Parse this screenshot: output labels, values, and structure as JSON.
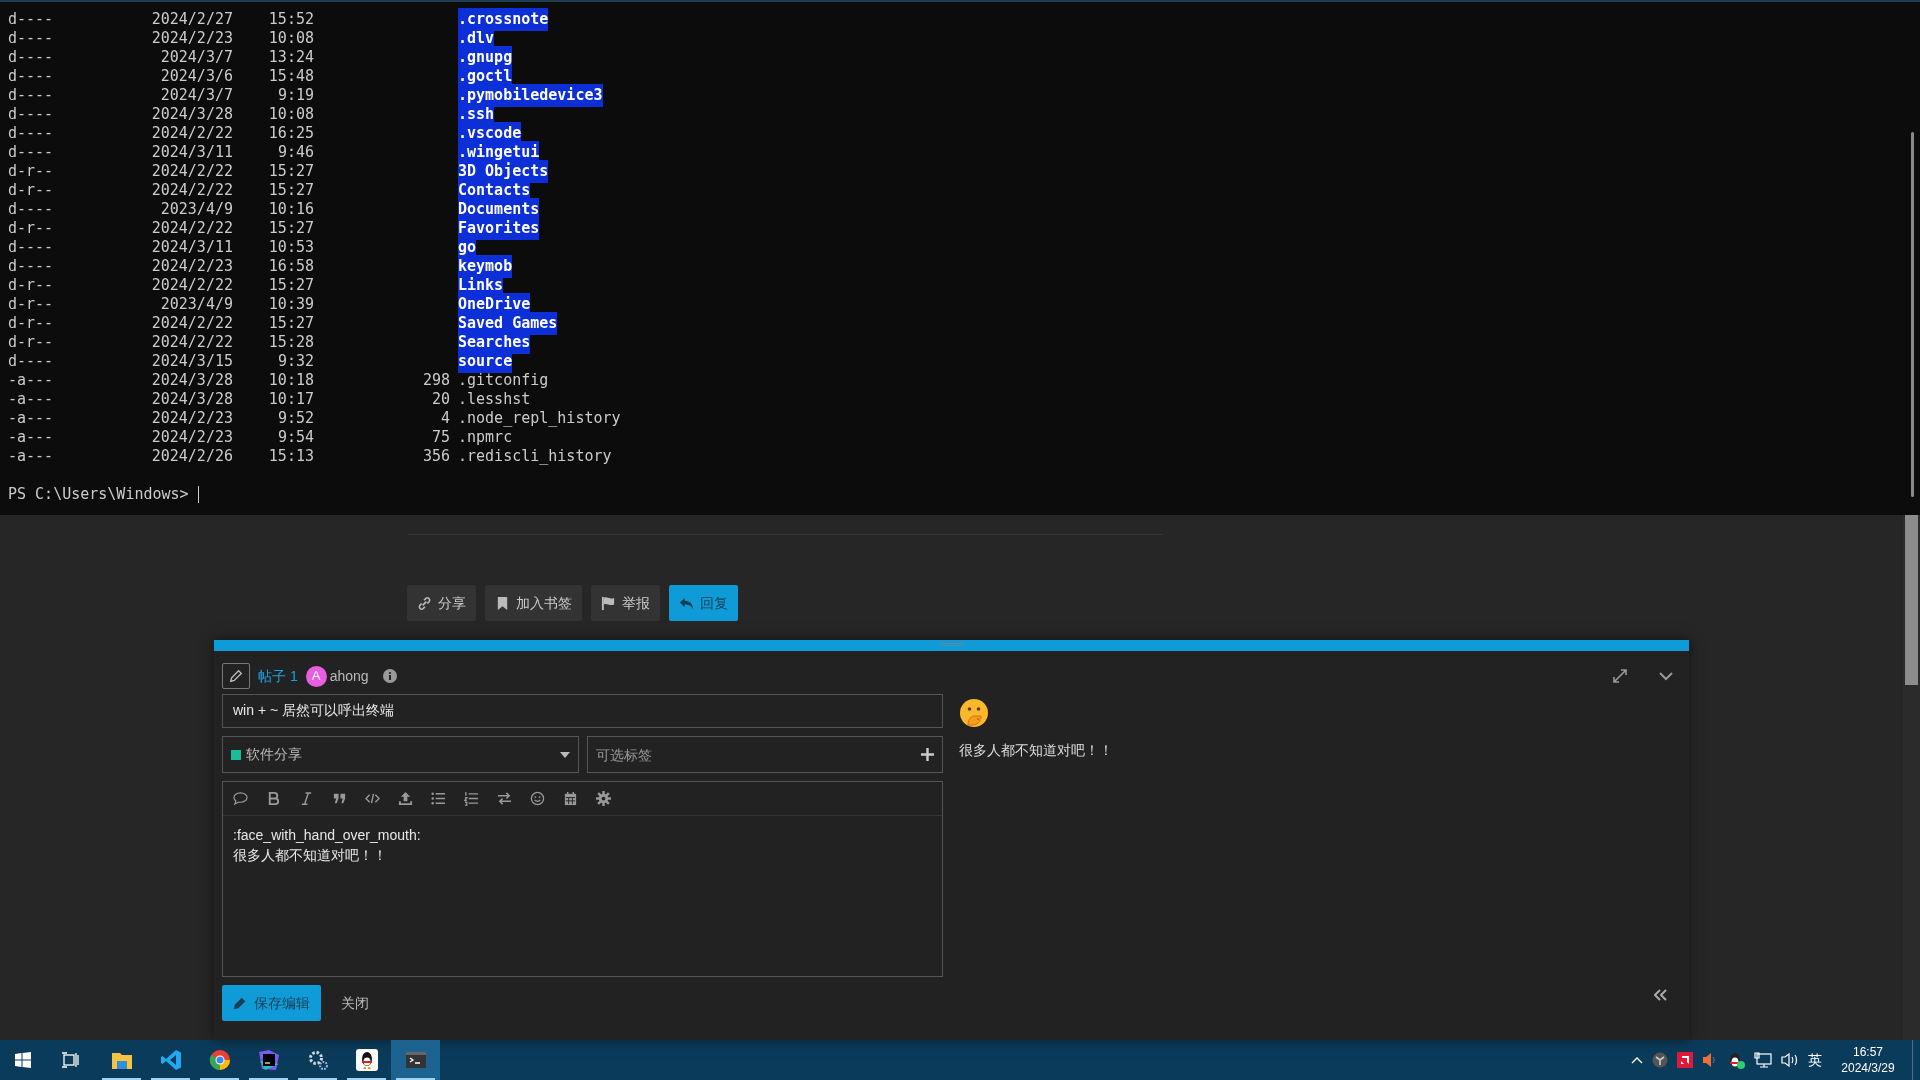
{
  "terminal": {
    "rows": [
      {
        "kind": "directory",
        "mode": "d----",
        "date": "2024/2/27",
        "time": "15:52",
        "name": ".crossnote"
      },
      {
        "kind": "directory",
        "mode": "d----",
        "date": "2024/2/23",
        "time": "10:08",
        "name": ".dlv"
      },
      {
        "kind": "directory",
        "mode": "d----",
        "date": "2024/3/7",
        "time": "13:24",
        "name": ".gnupg"
      },
      {
        "kind": "directory",
        "mode": "d----",
        "date": "2024/3/6",
        "time": "15:48",
        "name": ".goctl"
      },
      {
        "kind": "directory",
        "mode": "d----",
        "date": "2024/3/7",
        "time": "9:19",
        "name": ".pymobiledevice3"
      },
      {
        "kind": "directory",
        "mode": "d----",
        "date": "2024/3/28",
        "time": "10:08",
        "name": ".ssh"
      },
      {
        "kind": "directory",
        "mode": "d----",
        "date": "2024/2/22",
        "time": "16:25",
        "name": ".vscode"
      },
      {
        "kind": "directory",
        "mode": "d----",
        "date": "2024/3/11",
        "time": "9:46",
        "name": ".wingetui"
      },
      {
        "kind": "directory",
        "mode": "d-r--",
        "date": "2024/2/22",
        "time": "15:27",
        "name": "3D Objects"
      },
      {
        "kind": "directory",
        "mode": "d-r--",
        "date": "2024/2/22",
        "time": "15:27",
        "name": "Contacts"
      },
      {
        "kind": "directory",
        "mode": "d----",
        "date": "2023/4/9",
        "time": "10:16",
        "name": "Documents"
      },
      {
        "kind": "directory",
        "mode": "d-r--",
        "date": "2024/2/22",
        "time": "15:27",
        "name": "Favorites"
      },
      {
        "kind": "directory",
        "mode": "d----",
        "date": "2024/3/11",
        "time": "10:53",
        "name": "go"
      },
      {
        "kind": "directory",
        "mode": "d----",
        "date": "2024/2/23",
        "time": "16:58",
        "name": "keymob"
      },
      {
        "kind": "directory",
        "mode": "d-r--",
        "date": "2024/2/22",
        "time": "15:27",
        "name": "Links"
      },
      {
        "kind": "directory",
        "mode": "d-r--",
        "date": "2023/4/9",
        "time": "10:39",
        "name": "OneDrive"
      },
      {
        "kind": "directory",
        "mode": "d-r--",
        "date": "2024/2/22",
        "time": "15:27",
        "name": "Saved Games"
      },
      {
        "kind": "directory",
        "mode": "d-r--",
        "date": "2024/2/22",
        "time": "15:28",
        "name": "Searches"
      },
      {
        "kind": "directory",
        "mode": "d----",
        "date": "2024/3/15",
        "time": "9:32",
        "name": "source"
      },
      {
        "kind": "file",
        "mode": "-a---",
        "date": "2024/3/28",
        "time": "10:18",
        "length": "298",
        "name": ".gitconfig"
      },
      {
        "kind": "file",
        "mode": "-a---",
        "date": "2024/3/28",
        "time": "10:17",
        "length": "20",
        "name": ".lesshst"
      },
      {
        "kind": "file",
        "mode": "-a---",
        "date": "2024/2/23",
        "time": "9:52",
        "length": "4",
        "name": ".node_repl_history"
      },
      {
        "kind": "file",
        "mode": "-a---",
        "date": "2024/2/23",
        "time": "9:54",
        "length": "75",
        "name": ".npmrc"
      },
      {
        "kind": "file",
        "mode": "-a---",
        "date": "2024/2/26",
        "time": "15:13",
        "length": "356",
        "name": ".rediscli_history"
      }
    ],
    "prompt": "PS C:\\Users\\Windows>"
  },
  "action_buttons": [
    {
      "kind": "link",
      "label": "分享",
      "primary": false
    },
    {
      "kind": "bookmark",
      "label": "加入书签",
      "primary": false
    },
    {
      "kind": "flag",
      "label": "举报",
      "primary": false
    },
    {
      "kind": "reply",
      "label": "回复",
      "primary": true
    }
  ],
  "composer": {
    "post_label": "帖子 1",
    "avatar_letter": "A",
    "username": "ahong",
    "title_value": "win + ~ 居然可以呼出终端",
    "category": "软件分享",
    "tags_placeholder": "可选标签",
    "editor_lines": [
      ":face_with_hand_over_mouth:",
      "很多人都不知道对吧！！"
    ],
    "preview_text": "很多人都不知道对吧！！",
    "save_label": "保存编辑",
    "close_label": "关闭"
  },
  "taskbar": {
    "apps": [
      {
        "kind": "explorer",
        "running": true,
        "selected": false
      },
      {
        "kind": "vscode",
        "running": true,
        "selected": false
      },
      {
        "kind": "chrome",
        "running": true,
        "selected": false
      },
      {
        "kind": "goland",
        "running": true,
        "selected": false
      },
      {
        "kind": "settings",
        "running": true,
        "selected": false
      },
      {
        "kind": "qq",
        "running": true,
        "selected": false
      },
      {
        "kind": "terminal",
        "running": true,
        "selected": true
      }
    ],
    "ime": "英",
    "time": "16:57",
    "date": "2024/3/29"
  }
}
